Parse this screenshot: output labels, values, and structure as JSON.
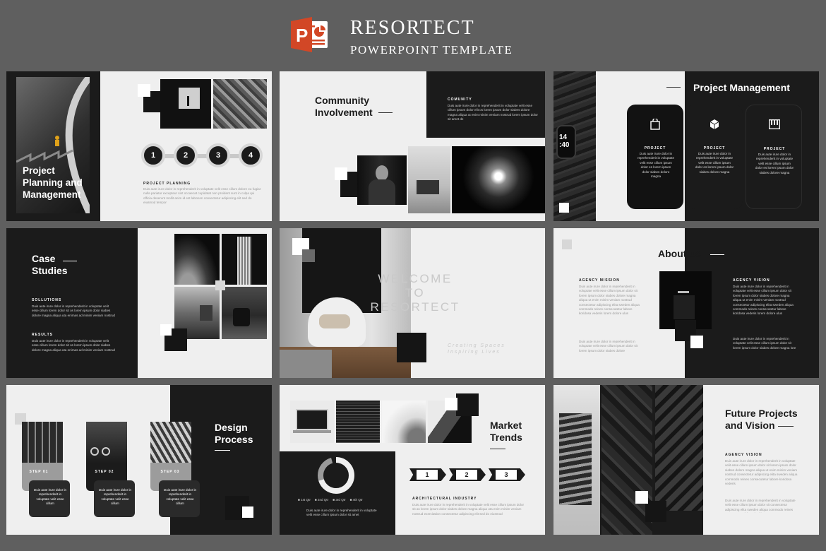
{
  "header": {
    "title": "RESORTECT",
    "subtitle": "POWERPOINT TEMPLATE",
    "logo_icon": "powerpoint-logo-icon",
    "logo_color": "#d24726"
  },
  "slides": {
    "s1": {
      "title": [
        "Project",
        "Planning and",
        "Management"
      ],
      "steps": [
        "1",
        "2",
        "3",
        "4"
      ],
      "label": "PROJECT PLANNING",
      "body": "Duis aute irure dolor in reprehenderit in voluptate velit esse cillum dolore eu fugiat nulla pariatur excepteur sint occaecat cupidatat non proident sunt in culpa qui officia deserunt mollit anim id est laborum consectetur adipiscing elit sed do eiusmod tempor"
    },
    "s2": {
      "title": [
        "Community",
        "Involvement"
      ],
      "label": "COMUNITY",
      "body": "Duis aute irure dolor in reprehenderit in voluptate velit esse cillum ipsum dolor elit os lorem ipsum dolor siabes dolore magna aliqua ut enim minim veniam nostrud lorem ipsum dolor sit amet de"
    },
    "s3": {
      "title": "Project Management",
      "cards": [
        {
          "label": "PROJECT",
          "body": "Duis aute irure dolor in reprehenderit in voluptate velit esse cillum ipsum dolor es lorem ipsum dolor siabes dolore magna"
        },
        {
          "label": "PROJECT",
          "body": "Duis aute irure dolor in reprehenderit in voluptate velit esse cillum ipsum dolor es lorem ipsum dolor siabes dolore magna"
        },
        {
          "label": "PROJECT",
          "body": "Duis aute irure dolor in reprehenderit in voluptate velit esse cillum ipsum dolor es lorem ipsum dolor siabes dolore magna"
        }
      ],
      "watch_text": [
        "14",
        ":40"
      ]
    },
    "s4": {
      "title": [
        "Case",
        "Studies"
      ],
      "label1": "SOLLUTIONS",
      "body1": "Duis aute irure dolor in reprehenderit in voluptate velit esse cillum lorem dolor sit os lorem ipsum dolor siabes dolore magna aliqua uta enimas ad minim veniam nostrud",
      "label2": "RESULTS",
      "body2": "Duis aute irure dolor in reprehenderit in voluptate velit esse cillum lorem dolor sit os lorem ipsum dolor siabes dolore magna aliqua uta enimas ad minim veniam nostrud"
    },
    "s5": {
      "welcome1": "WELCOME TO",
      "welcome2": "RESORTECT",
      "tag1": "Creating Spaces",
      "tag2": "Inspiring Lives"
    },
    "s6": {
      "title": "About us",
      "label1": "AGENCY MISSION",
      "body1": "Duis aute irure dolor in reprehenderit in voluptate velit esse cillum ipsum dolor sit lorem ipsum dolor siabes dolore magna aliqua ut enim minim veniam nostrud consectetur adipiscing elita sweden aliqua commodo reines consecutetur labore koridosa vederis lorem dolore ulus",
      "body1b": "Duis aute irure dolor in reprehenderit in voluptate velit esse cillum ipsum dolor sit lorem ipsum dolor siabes dolore",
      "label2": "AGENCY VISION",
      "body2": "Duis aute irure dolor in reprehenderit in voluptate velit esse cillum ipsum dolor sit lorem ipsum dolor siabes dolore magna aliqua ut enim minim veniam nostrud consectetur adipiscing elita sweden aliqua commodo reines consecutetur labore koridosa vederis lorem dolore ulus",
      "body2b": "Duis aute irure dolor in reprehenderit in voluptate velit esse cillum ipsum dolor sit lorem ipsum dolor siabes dolore magna lore"
    },
    "s7": {
      "title": [
        "Design",
        "Process"
      ],
      "steps": [
        {
          "label": "STEP 01",
          "body": "Duis aute irure dolor in reprehenderit in voluptate velit esse cillum"
        },
        {
          "label": "STEP 02",
          "body": "Duis aute irure dolor in reprehenderit in voluptate velit esse cillum"
        },
        {
          "label": "STEP 03",
          "body": "Duis aute irure dolor in reprehenderit in voluptate velit esse cillum"
        }
      ]
    },
    "s8": {
      "title": [
        "Market",
        "Trends"
      ],
      "legend": [
        "1st Qtr",
        "2nd Qtr",
        "3rd Qtr",
        "4th Qtr"
      ],
      "body_left": "Duis aute irure dolor in reprehenderit in voluptate velit esse cillum ipsum dolor sit amet",
      "arrows": [
        "1",
        "2",
        "3"
      ],
      "label": "ARCHITECTURAL INDUSTRY",
      "body": "Duis aute irure dolor in reprehenderit in voluptate velit esse cillum ipsum dolor sit as lorem ipsum dolor siabes dolore magna aliqua uta enim minim veniam nostrud exercitation consectetur adipiscing elit sed do eiusmod"
    },
    "s9": {
      "title": [
        "Future Projects",
        "and Vision"
      ],
      "label": "AGENCY VISION",
      "body": "Duis aute irure dolor in reprehenderit in voluptate velit esse cillum ipsum dolor sit lorem ipsum dolor siabes dolore magna aliqua ut enim minim veniam nostrud consectetur adipiscing elita sweden aliqua commodo reines consecutetur labore koridosa vederis",
      "body2": "Duis aute irure dolor in reprehenderit in voluptate velit esse cillum ipsum dolor sit consectetur adipiscing elita sweden aliqua commodo reines consecutetur labore koridosa"
    }
  }
}
